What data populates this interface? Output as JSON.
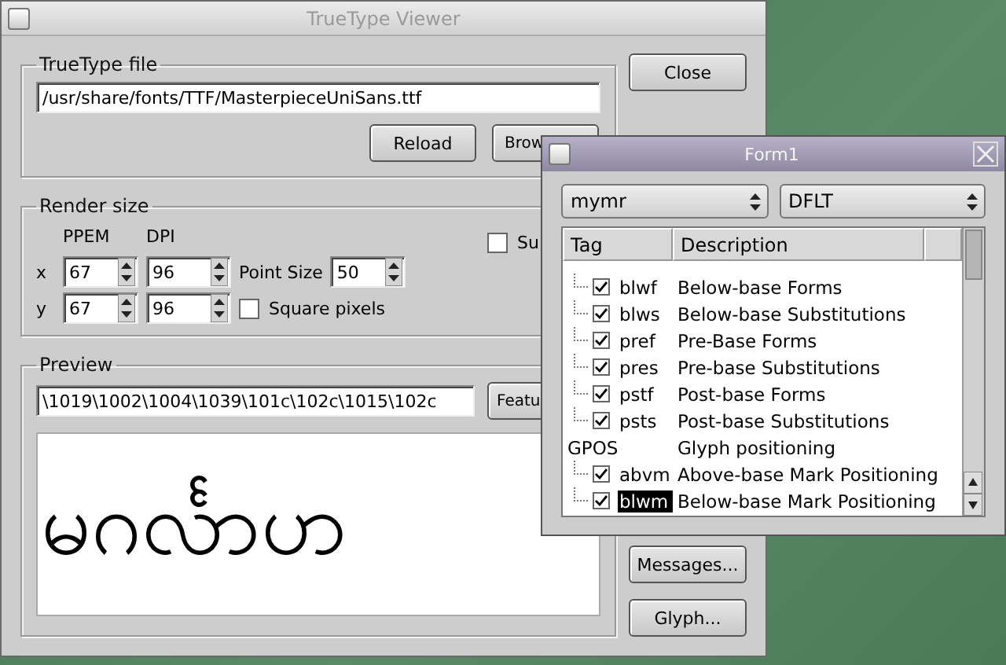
{
  "main_window": {
    "title": "TrueType Viewer",
    "file_group": {
      "label": "TrueType file",
      "path": "/usr/share/fonts/TTF/MasterpieceUniSans.ttf",
      "buttons": [
        "Reload",
        "Brow"
      ]
    },
    "render_group": {
      "label": "Render size",
      "ppem_label": "PPEM",
      "dpi_label": "DPI",
      "rows": [
        {
          "axis": "x",
          "ppem": "67",
          "dpi": "96"
        },
        {
          "axis": "y",
          "ppem": "67",
          "dpi": "96"
        }
      ],
      "point_size_label": "Point Size",
      "point_size": "50",
      "square_pixels": {
        "label": "Square pixels",
        "checked": false
      },
      "cut_checkbox": {
        "label": "Su",
        "checked": false
      }
    },
    "preview_group": {
      "label": "Preview",
      "input": "\\1019\\1002\\1004\\1039\\101c\\102c\\1015\\102c",
      "button": "Featu",
      "preview_text": "မဂင်္လာပာ"
    },
    "side_buttons": [
      "Close",
      "Messages...",
      "Glyph..."
    ]
  },
  "form_window": {
    "title": "Form1",
    "script": "mymr",
    "language": "DFLT",
    "columns": [
      "Tag",
      "Description"
    ],
    "tree": [
      {
        "children": [
          {
            "tag": "blwf",
            "description": "Below-base Forms",
            "checked": true,
            "selected": false
          },
          {
            "tag": "blws",
            "description": "Below-base Substitutions",
            "checked": true,
            "selected": false
          },
          {
            "tag": "pref",
            "description": "Pre-Base Forms",
            "checked": true,
            "selected": false
          },
          {
            "tag": "pres",
            "description": "Pre-base Substitutions",
            "checked": true,
            "selected": false
          },
          {
            "tag": "pstf",
            "description": "Post-base Forms",
            "checked": true,
            "selected": false
          },
          {
            "tag": "psts",
            "description": "Post-base Substitutions",
            "checked": true,
            "selected": false
          }
        ]
      },
      {
        "tag": "GPOS",
        "description": "Glyph positioning",
        "children": [
          {
            "tag": "abvm",
            "description": "Above-base Mark Positioning",
            "checked": true,
            "selected": false
          },
          {
            "tag": "blwm",
            "description": "Below-base Mark Positioning",
            "checked": true,
            "selected": true
          }
        ]
      }
    ]
  }
}
